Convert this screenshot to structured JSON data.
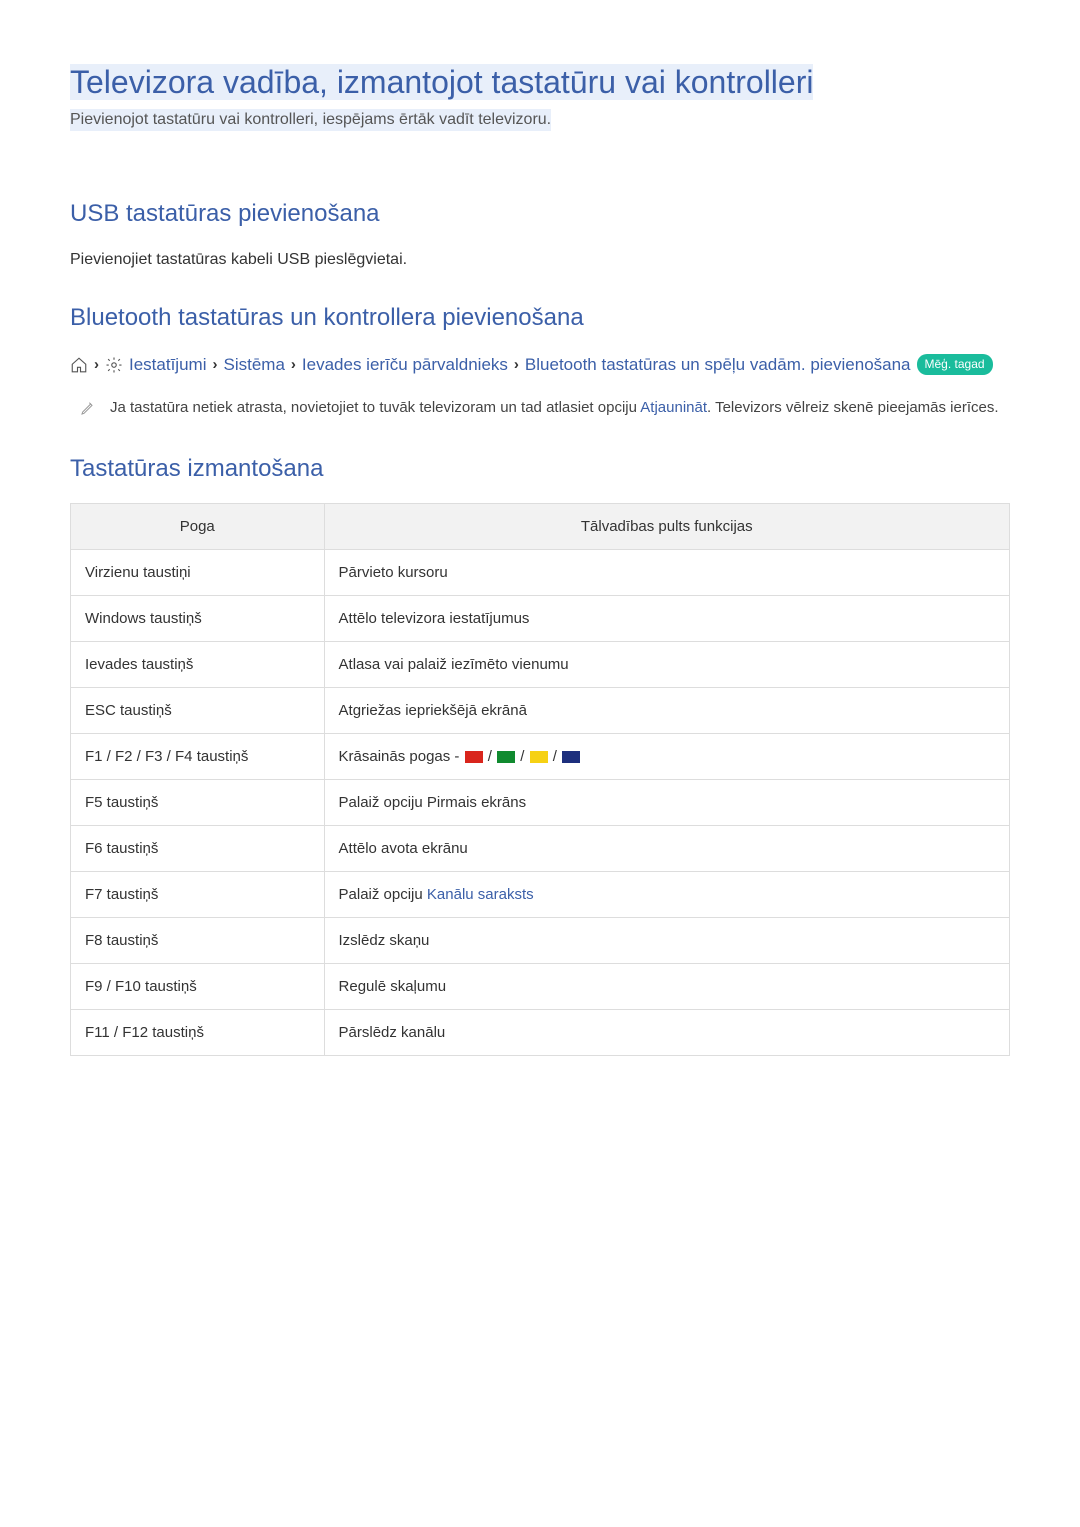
{
  "title": "Televizora vadība, izmantojot tastatūru vai kontrolleri",
  "subtitle": "Pievienojot tastatūru vai kontrolleri, iespējams ērtāk vadīt televizoru.",
  "sections": {
    "usb": {
      "heading": "USB tastatūras pievienošana",
      "body": "Pievienojiet tastatūras kabeli USB pieslēgvietai."
    },
    "bt": {
      "heading": "Bluetooth tastatūras un kontrollera pievienošana",
      "breadcrumb": {
        "items": [
          "Iestatījumi",
          "Sistēma",
          "Ievades ierīču pārvaldnieks",
          "Bluetooth tastatūras un spēļu vadām. pievienošana"
        ],
        "badge": "Mēģ. tagad"
      },
      "note_prefix": "Ja tastatūra netiek atrasta, novietojiet to tuvāk televizoram un tad atlasiet opciju ",
      "note_link": "Atjaunināt",
      "note_suffix": ". Televizors vēlreiz skenē pieejamās ierīces."
    },
    "usage": {
      "heading": "Tastatūras izmantošana",
      "table": {
        "headers": [
          "Poga",
          "Tālvadības pults funkcijas"
        ],
        "rows": [
          {
            "key": "Virzienu taustiņi",
            "fn": "Pārvieto kursoru"
          },
          {
            "key": "Windows taustiņš",
            "fn": "Attēlo televizora iestatījumus"
          },
          {
            "key": "Ievades taustiņš",
            "fn": "Atlasa vai palaiž iezīmēto vienumu"
          },
          {
            "key": "ESC taustiņš",
            "fn": "Atgriežas iepriekšējā ekrānā"
          },
          {
            "key": "F1 / F2 / F3 / F4 taustiņš",
            "fn_prefix": "Krāsainās pogas - ",
            "colors": true
          },
          {
            "key": "F5 taustiņš",
            "fn": "Palaiž opciju Pirmais ekrāns"
          },
          {
            "key": "F6 taustiņš",
            "fn": "Attēlo avota ekrānu"
          },
          {
            "key": "F7 taustiņš",
            "fn_prefix": "Palaiž opciju ",
            "fn_link": "Kanālu saraksts"
          },
          {
            "key": "F8 taustiņš",
            "fn": "Izslēdz skaņu"
          },
          {
            "key": "F9 / F10 taustiņš",
            "fn": "Regulē skaļumu"
          },
          {
            "key": "F11 / F12 taustiņš",
            "fn": "Pārslēdz kanālu"
          }
        ]
      }
    }
  }
}
